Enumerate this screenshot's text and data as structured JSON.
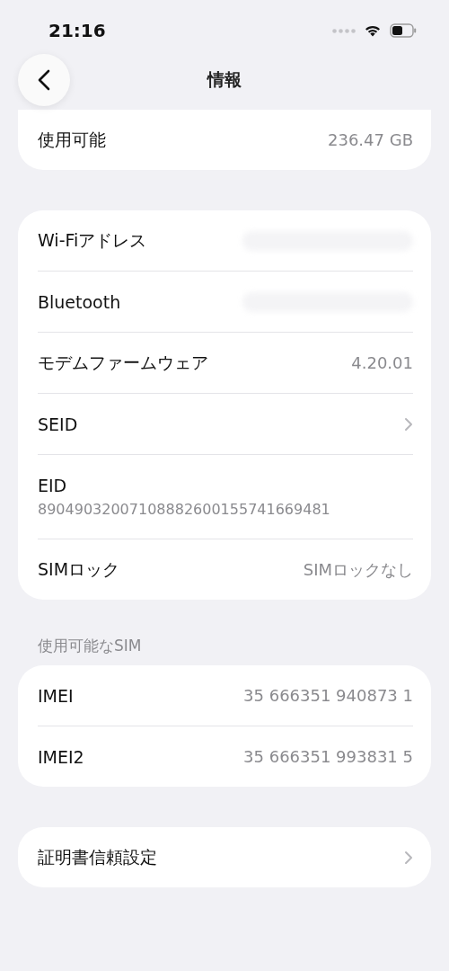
{
  "status_bar": {
    "time": "21:16"
  },
  "nav": {
    "title": "情報"
  },
  "storage_section": {
    "rows": [
      {
        "kind": "value",
        "label": "使用可能",
        "value": "236.47 GB"
      }
    ]
  },
  "network_section": {
    "rows": [
      {
        "kind": "redacted",
        "label": "Wi-Fiアドレス"
      },
      {
        "kind": "redacted",
        "label": "Bluetooth"
      },
      {
        "kind": "value",
        "label": "モデムファームウェア",
        "value": "4.20.01"
      },
      {
        "kind": "chevron",
        "label": "SEID"
      },
      {
        "kind": "stacked",
        "label": "EID",
        "value": "89049032007108882600155741669481"
      },
      {
        "kind": "value",
        "label": "SIMロック",
        "value": "SIMロックなし"
      }
    ]
  },
  "sim_section": {
    "header": "使用可能なSIM",
    "rows": [
      {
        "kind": "value",
        "label": "IMEI",
        "value": "35 666351 940873 1"
      },
      {
        "kind": "value",
        "label": "IMEI2",
        "value": "35 666351 993831 5"
      }
    ]
  },
  "certificate_section": {
    "rows": [
      {
        "kind": "chevron",
        "label": "証明書信頼設定"
      }
    ]
  }
}
